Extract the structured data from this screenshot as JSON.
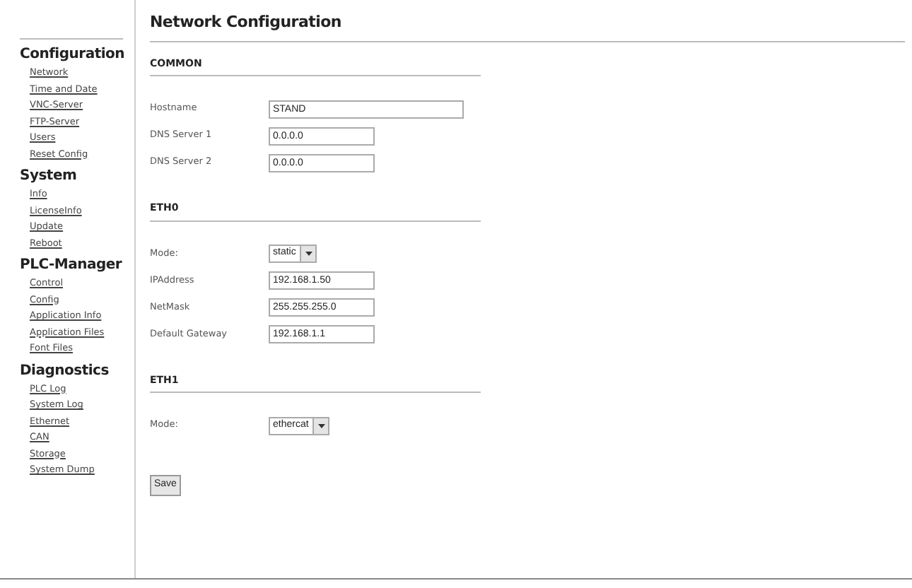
{
  "sidebar": {
    "groups": [
      {
        "title": "Configuration",
        "items": [
          "Network",
          "Time and Date",
          "VNC-Server",
          "FTP-Server",
          "Users",
          "Reset Config"
        ]
      },
      {
        "title": "System",
        "items": [
          "Info",
          "LicenseInfo",
          "Update",
          "Reboot"
        ]
      },
      {
        "title": "PLC-Manager",
        "items": [
          "Control",
          "Config",
          "Application Info",
          "Application Files",
          "Font Files"
        ]
      },
      {
        "title": "Diagnostics",
        "items": [
          "PLC Log",
          "System Log",
          "Ethernet",
          "CAN",
          "Storage",
          "System Dump"
        ]
      }
    ]
  },
  "title": "Network Configuration",
  "sections": [
    {
      "title": "COMMON",
      "fields": [
        {
          "kind": "long_text",
          "label": "Hostname",
          "value": "STAND"
        },
        {
          "kind": "text",
          "label": "DNS Server 1",
          "value": "0.0.0.0"
        },
        {
          "kind": "text",
          "label": "DNS Server 2",
          "value": "0.0.0.0"
        }
      ]
    },
    {
      "title": "ETH0",
      "fields": [
        {
          "kind": "select",
          "label": "Mode:",
          "value": "static"
        },
        {
          "kind": "text",
          "label": "IPAddress",
          "value": "192.168.1.50"
        },
        {
          "kind": "text",
          "label": "NetMask",
          "value": "255.255.255.0"
        },
        {
          "kind": "text",
          "label": "Default Gateway",
          "value": "192.168.1.1"
        }
      ]
    },
    {
      "title": "ETH1",
      "fields": [
        {
          "kind": "select",
          "label": "Mode:",
          "value": "ethercat"
        }
      ]
    }
  ],
  "save_button": "Save"
}
